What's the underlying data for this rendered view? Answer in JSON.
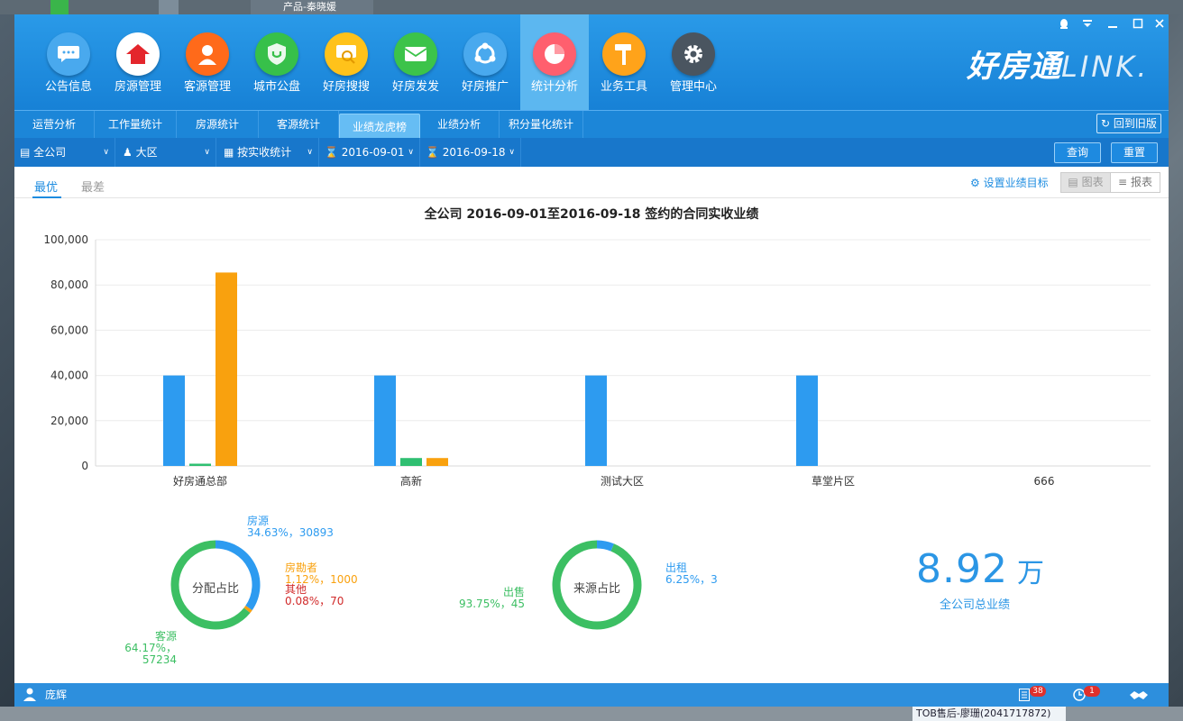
{
  "desktop": {
    "top_chip": "产品-秦晓媛",
    "bottom_chip": "TOB售后-廖珊(2041717872)"
  },
  "app": {
    "brand_cn": "好房通",
    "brand_en": "LINK.",
    "nav": [
      {
        "label": "公告信息",
        "icon": "chat-bubble-icon",
        "color": "#49a9ee"
      },
      {
        "label": "房源管理",
        "icon": "house-icon",
        "color": "#ffffff"
      },
      {
        "label": "客源管理",
        "icon": "person-icon",
        "color": "#ff6a1a"
      },
      {
        "label": "城市公盘",
        "icon": "shield-icon",
        "color": "#37c04a"
      },
      {
        "label": "好房搜搜",
        "icon": "search-icon",
        "color": "#ffc21a"
      },
      {
        "label": "好房发发",
        "icon": "mail-icon",
        "color": "#3cc34a"
      },
      {
        "label": "好房推广",
        "icon": "share-icon",
        "color": "#49a9ee"
      },
      {
        "label": "统计分析",
        "icon": "pie-chart-icon",
        "color": "#ff5f6e"
      },
      {
        "label": "业务工具",
        "icon": "hammer-icon",
        "color": "#ffa31a"
      },
      {
        "label": "管理中心",
        "icon": "gear-icon",
        "color": "#4a5560"
      }
    ],
    "tabs": [
      "运营分析",
      "工作量统计",
      "房源统计",
      "客源统计",
      "业绩龙虎榜",
      "业绩分析",
      "积分量化统计"
    ],
    "back_old": "回到旧版",
    "filters": {
      "company": "全公司",
      "region": "大区",
      "stat_type": "按实收统计",
      "start_date": "2016-09-01",
      "end_date": "2016-09-18"
    },
    "query_label": "查询",
    "reset_label": "重置",
    "subtabs": [
      "最优",
      "最差"
    ],
    "set_goal": "设置业绩目标",
    "view_chart": "图表",
    "view_report": "报表",
    "chart_title": "全公司 2016-09-01至2016-09-18 签约的合同实收业绩",
    "donut1": {
      "center": "分配占比",
      "labels": [
        {
          "name": "房源",
          "value": "34.63%，30893"
        },
        {
          "name": "房勘者",
          "value": "1.12%，1000"
        },
        {
          "name": "其他",
          "value": "0.08%，70"
        },
        {
          "name": "客源",
          "value": "64.17%，57234"
        }
      ]
    },
    "donut2": {
      "center": "来源占比",
      "labels": [
        {
          "name": "出租",
          "value": "6.25%，3"
        },
        {
          "name": "出售",
          "value": "93.75%，45"
        }
      ]
    },
    "total": {
      "value": "8.92",
      "unit": "万",
      "label": "全公司总业绩"
    },
    "status": {
      "user": "庞辉",
      "badge1": "38",
      "badge2": "1"
    }
  },
  "chart_data": {
    "type": "bar",
    "title": "全公司 2016-09-01至2016-09-18 签约的合同实收业绩",
    "categories": [
      "好房通总部",
      "高新",
      "测试大区",
      "草堂片区",
      "666"
    ],
    "series": [
      {
        "color": "#2d9bf0",
        "values": [
          40000,
          40000,
          40000,
          40000,
          0
        ]
      },
      {
        "color": "#2fbf71",
        "values": [
          1000,
          3500,
          0,
          0,
          0
        ]
      },
      {
        "color": "#f9a10e",
        "values": [
          85500,
          3500,
          0,
          0,
          0
        ]
      }
    ],
    "yticks": [
      "0",
      "20,000",
      "40,000",
      "60,000",
      "80,000",
      "100,000"
    ],
    "ylim": [
      0,
      100000
    ],
    "grid": true
  },
  "donut_data": [
    {
      "slices": [
        {
          "name": "房源",
          "value": 34.63,
          "color": "#2d9bf0"
        },
        {
          "name": "房勘者",
          "value": 1.12,
          "color": "#f9a10e"
        },
        {
          "name": "其他",
          "value": 0.08,
          "color": "#d12a2a"
        },
        {
          "name": "客源",
          "value": 64.17,
          "color": "#3cbf63"
        }
      ]
    },
    {
      "slices": [
        {
          "name": "出租",
          "value": 6.25,
          "color": "#2d9bf0"
        },
        {
          "name": "出售",
          "value": 93.75,
          "color": "#3cbf63"
        }
      ]
    }
  ]
}
